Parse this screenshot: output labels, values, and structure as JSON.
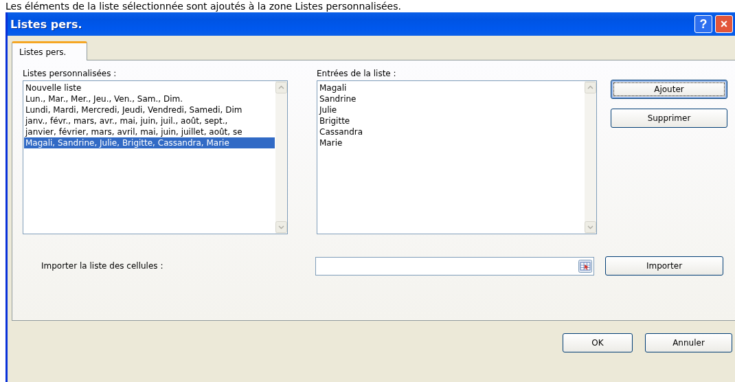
{
  "caption": "Les éléments de la liste sélectionnée sont ajoutés à la zone Listes personnalisées.",
  "window": {
    "title": "Listes pers.",
    "title_buttons": [
      "?",
      "×"
    ]
  },
  "tabs": [
    {
      "label": "Listes pers.",
      "selected": true
    }
  ],
  "custom_lists": {
    "label": "Listes personnalisées :",
    "items": [
      {
        "text": "Nouvelle liste",
        "selected": false
      },
      {
        "text": "Lun., Mar., Mer., Jeu., Ven., Sam., Dim.",
        "selected": false
      },
      {
        "text": "Lundi, Mardi, Mercredi, Jeudi, Vendredi, Samedi, Dim",
        "selected": false
      },
      {
        "text": "janv., févr., mars, avr., mai, juin, juil., août, sept.,",
        "selected": false
      },
      {
        "text": "janvier, février, mars, avril, mai, juin, juillet, août, se",
        "selected": false
      },
      {
        "text": "Magali, Sandrine, Julie, Brigitte, Cassandra, Marie",
        "selected": true
      }
    ]
  },
  "list_entries": {
    "label": "Entrées de la liste :",
    "items": [
      "Magali",
      "Sandrine",
      "Julie",
      "Brigitte",
      "Cassandra",
      "Marie"
    ]
  },
  "side_buttons": [
    {
      "label": "Ajouter",
      "focused": true
    },
    {
      "label": "Supprimer",
      "focused": false
    }
  ],
  "import": {
    "label": "Importer la liste des cellules :",
    "button": "Importer"
  },
  "footer_buttons": [
    "OK",
    "Annuler"
  ]
}
